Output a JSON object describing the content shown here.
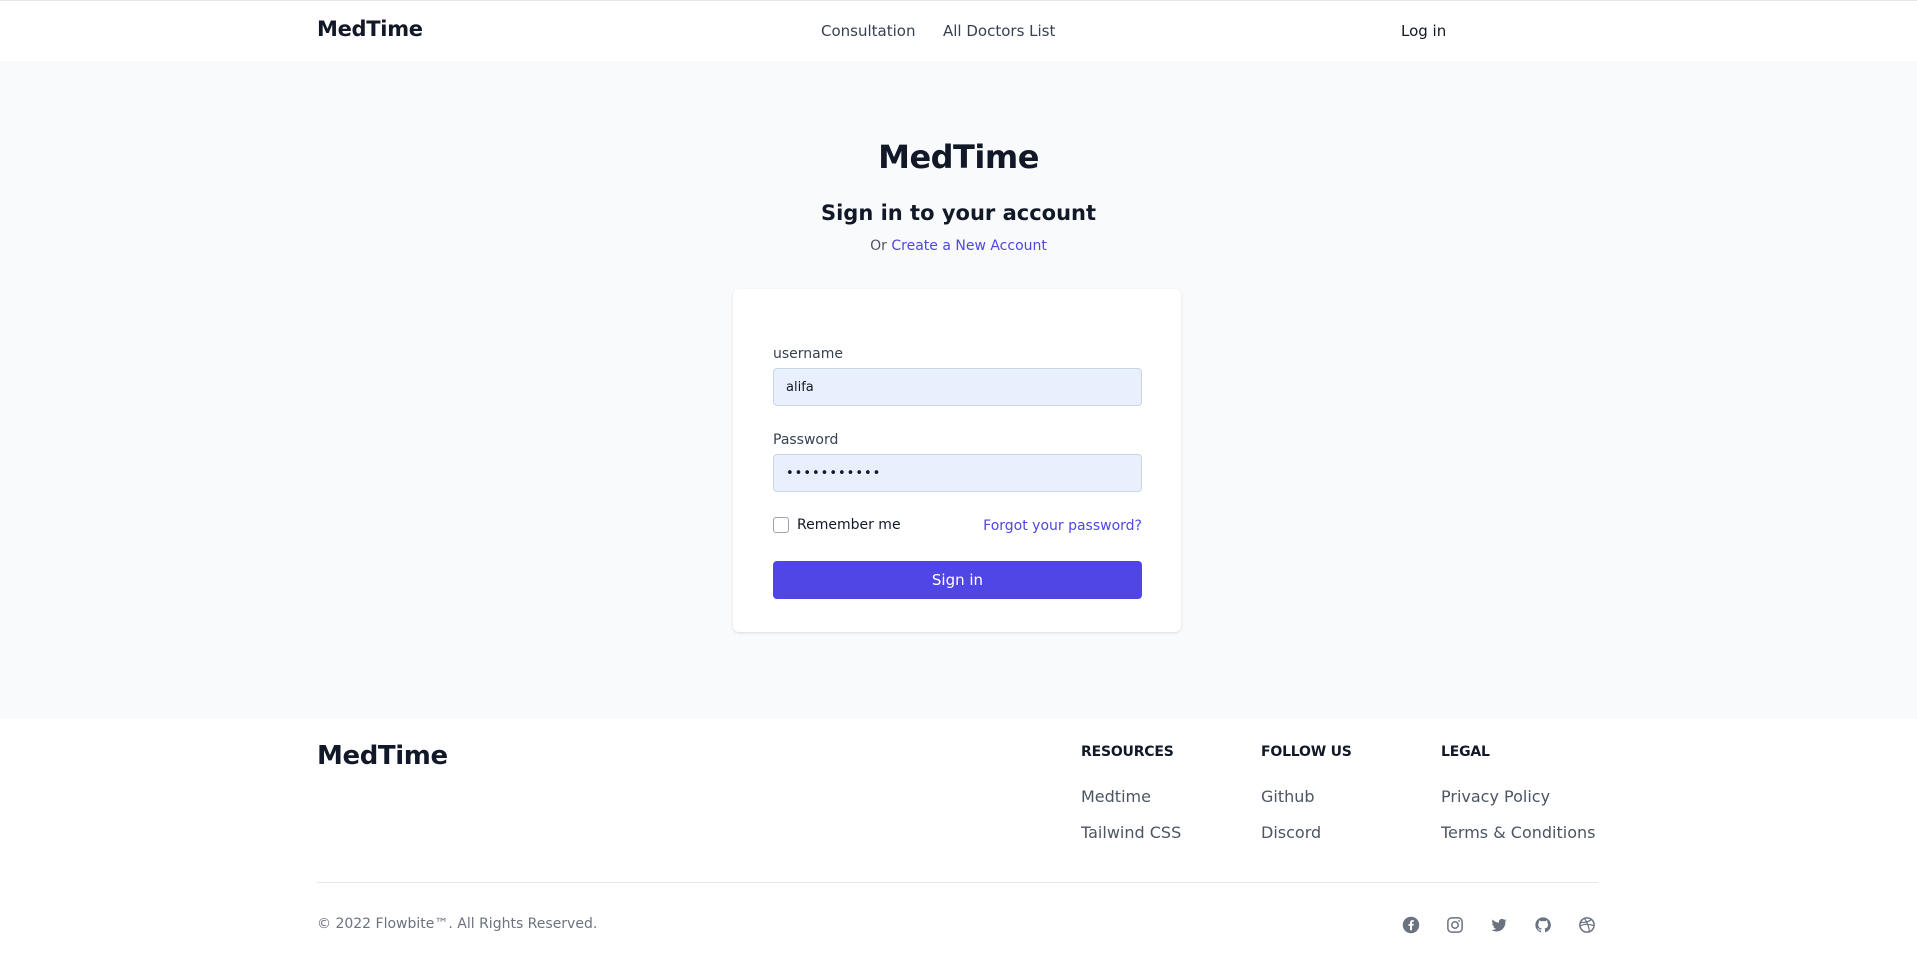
{
  "nav": {
    "brand": "MedTime",
    "links": [
      "Consultation",
      "All Doctors List"
    ],
    "login": "Log in"
  },
  "signin": {
    "title": "MedTime",
    "subtitle": "Sign in to your account",
    "or_prefix": "Or",
    "create_link": "Create a New Account",
    "username_label": "username",
    "username_value": "alifa",
    "password_label": "Password",
    "password_value": "•••••••••••",
    "remember_label": "Remember me",
    "remember_checked": false,
    "forgot_link": "Forgot your password?",
    "submit_label": "Sign in"
  },
  "footer": {
    "brand": "MedTime",
    "columns": [
      {
        "heading": "RESOURCES",
        "links": [
          "Medtime",
          "Tailwind CSS"
        ]
      },
      {
        "heading": "FOLLOW US",
        "links": [
          "Github",
          "Discord"
        ]
      },
      {
        "heading": "LEGAL",
        "links": [
          "Privacy Policy",
          "Terms & Conditions"
        ]
      }
    ],
    "copyright": "© 2022 Flowbite™. All Rights Reserved.",
    "social_icons": [
      "facebook-icon",
      "instagram-icon",
      "twitter-icon",
      "github-icon",
      "dribbble-icon"
    ]
  },
  "colors": {
    "accent": "#4f46e5",
    "page_bg": "#f9fafb",
    "input_bg": "#e8f0fe",
    "icon_gray": "#6b7280"
  }
}
